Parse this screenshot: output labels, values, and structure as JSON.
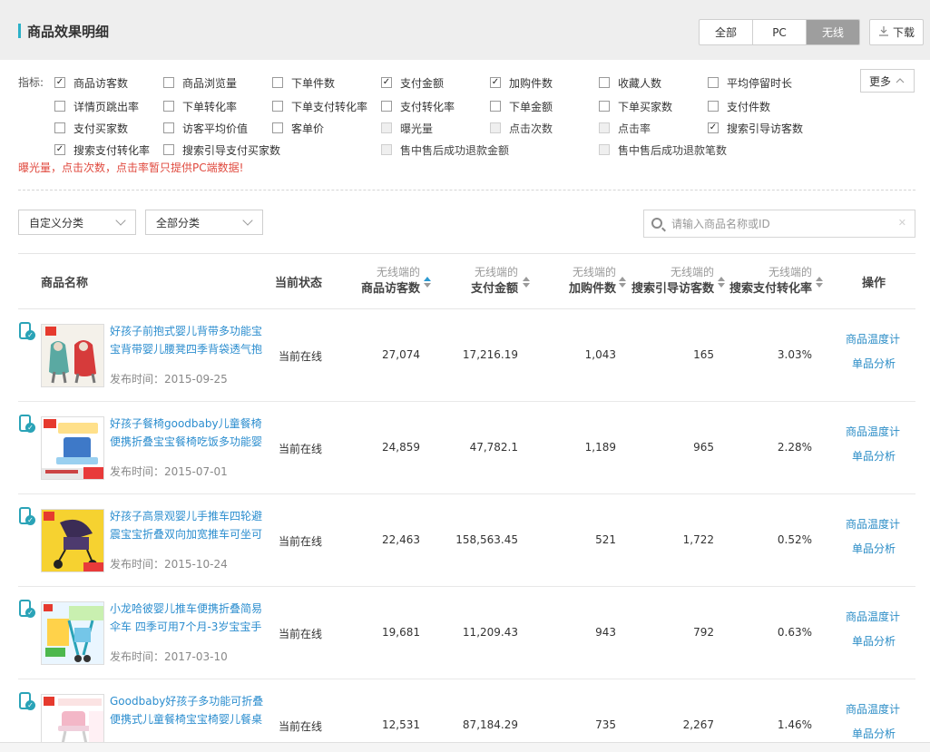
{
  "header": {
    "title": "商品效果明细",
    "segments": [
      {
        "label": "全部",
        "active": false
      },
      {
        "label": "PC",
        "active": false
      },
      {
        "label": "无线",
        "active": true
      }
    ],
    "download_label": "下载"
  },
  "indicators": {
    "label": "指标:",
    "more_label": "更多",
    "options": [
      {
        "label": "商品访客数",
        "checked": true,
        "disabled": false
      },
      {
        "label": "商品浏览量",
        "checked": false,
        "disabled": false
      },
      {
        "label": "下单件数",
        "checked": false,
        "disabled": false
      },
      {
        "label": "支付金额",
        "checked": true,
        "disabled": false
      },
      {
        "label": "加购件数",
        "checked": true,
        "disabled": false
      },
      {
        "label": "收藏人数",
        "checked": false,
        "disabled": false
      },
      {
        "label": "平均停留时长",
        "checked": false,
        "disabled": false
      },
      {
        "label": "详情页跳出率",
        "checked": false,
        "disabled": false
      },
      {
        "label": "下单转化率",
        "checked": false,
        "disabled": false
      },
      {
        "label": "下单支付转化率",
        "checked": false,
        "disabled": false
      },
      {
        "label": "支付转化率",
        "checked": false,
        "disabled": false
      },
      {
        "label": "下单金额",
        "checked": false,
        "disabled": false
      },
      {
        "label": "下单买家数",
        "checked": false,
        "disabled": false
      },
      {
        "label": "支付件数",
        "checked": false,
        "disabled": false
      },
      {
        "label": "支付买家数",
        "checked": false,
        "disabled": false
      },
      {
        "label": "访客平均价值",
        "checked": false,
        "disabled": false
      },
      {
        "label": "客单价",
        "checked": false,
        "disabled": false
      },
      {
        "label": "曝光量",
        "checked": false,
        "disabled": true
      },
      {
        "label": "点击次数",
        "checked": false,
        "disabled": true
      },
      {
        "label": "点击率",
        "checked": false,
        "disabled": true
      },
      {
        "label": "搜索引导访客数",
        "checked": true,
        "disabled": false
      },
      {
        "label": "搜索支付转化率",
        "checked": true,
        "disabled": false
      },
      {
        "label": "搜索引导支付买家数",
        "checked": false,
        "disabled": false
      },
      {
        "label": "售中售后成功退款金额",
        "checked": false,
        "disabled": true
      },
      {
        "label": "售中售后成功退款笔数",
        "checked": false,
        "disabled": true
      }
    ],
    "notice": "曝光量，点击次数，点击率暂只提供PC端数据!"
  },
  "filters": {
    "custom_category": "自定义分类",
    "all_category": "全部分类",
    "search_placeholder": "请输入商品名称或ID"
  },
  "table": {
    "col_name": "商品名称",
    "col_status": "当前状态",
    "col_op": "操作",
    "metric_cols": [
      {
        "sub": "无线端的",
        "main": "商品访客数",
        "sort_active": true
      },
      {
        "sub": "无线端的",
        "main": "支付金额",
        "sort_active": false
      },
      {
        "sub": "无线端的",
        "main": "加购件数",
        "sort_active": false
      },
      {
        "sub": "无线端的",
        "main": "搜索引导访客数",
        "sort_active": false
      },
      {
        "sub": "无线端的",
        "main": "搜索支付转化率",
        "sort_active": false
      }
    ],
    "op_labels": {
      "temp": "商品温度计",
      "analysis": "单品分析"
    },
    "rows": [
      {
        "name": "好孩子前抱式婴儿背带多功能宝宝背带婴儿腰凳四季背袋透气抱",
        "date": "发布时间：2015-09-25",
        "status": "当前在线",
        "visitors": "27,074",
        "pay": "17,216.19",
        "cart": "1,043",
        "search_visitors": "165",
        "search_conv": "3.03%",
        "thumb": "baby-carrier"
      },
      {
        "name": "好孩子餐椅goodbaby儿童餐椅便携折叠宝宝餐椅吃饭多功能婴儿",
        "date": "发布时间：2015-07-01",
        "status": "当前在线",
        "visitors": "24,859",
        "pay": "47,782.1",
        "cart": "1,189",
        "search_visitors": "965",
        "search_conv": "2.28%",
        "thumb": "booster-seat"
      },
      {
        "name": "好孩子高景观婴儿手推车四轮避震宝宝折叠双向加宽推车可坐可",
        "date": "发布时间：2015-10-24",
        "status": "当前在线",
        "visitors": "22,463",
        "pay": "158,563.45",
        "cart": "521",
        "search_visitors": "1,722",
        "search_conv": "0.52%",
        "thumb": "stroller"
      },
      {
        "name": "小龙哈彼婴儿推车便携折叠简易伞车 四季可用7个月-3岁宝宝手",
        "date": "发布时间：2017-03-10",
        "status": "当前在线",
        "visitors": "19,681",
        "pay": "11,209.43",
        "cart": "943",
        "search_visitors": "792",
        "search_conv": "0.63%",
        "thumb": "umbrella-stroller"
      },
      {
        "name": "Goodbaby好孩子多功能可折叠便携式儿童餐椅宝宝椅婴儿餐桌",
        "date": "",
        "status": "当前在线",
        "visitors": "12,531",
        "pay": "87,184.29",
        "cart": "735",
        "search_visitors": "2,267",
        "search_conv": "1.46%",
        "thumb": "high-chair"
      }
    ]
  },
  "colors": {
    "accent": "#2bb1c8",
    "link": "#2c8ecf",
    "notice": "#e04a3f",
    "active_segment": "#9e9e9e"
  }
}
